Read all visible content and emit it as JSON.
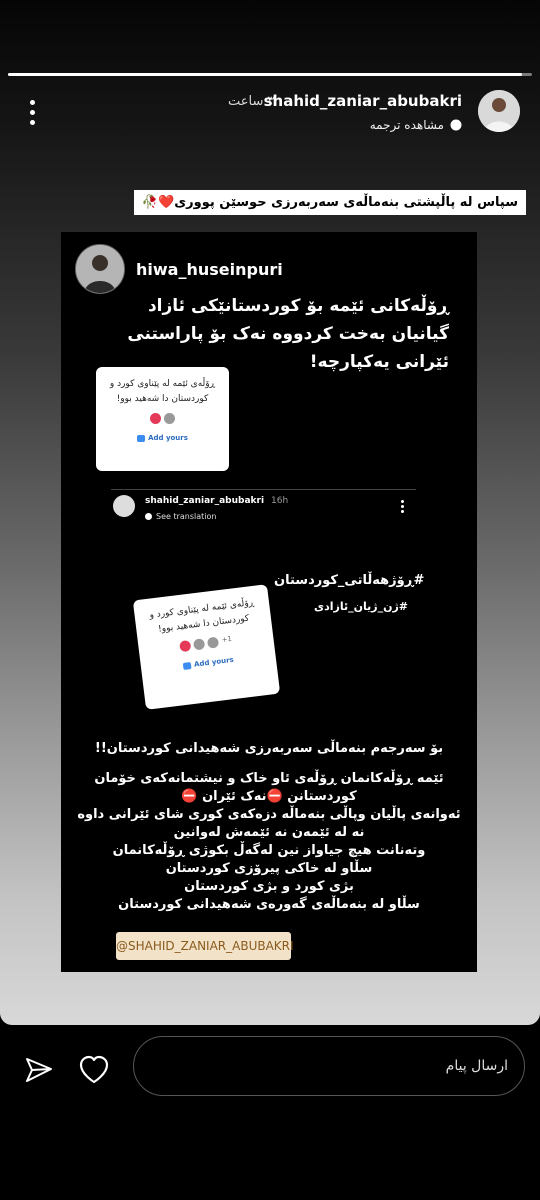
{
  "progress": {
    "fraction": 0.98
  },
  "header": {
    "username": "shahid_zaniar_abubakri",
    "time_ago": "٣ ساعت",
    "translate": "مشاهده ترجمه"
  },
  "caption": {
    "text": "سپاس لە پاڵپشتی بنەماڵەی سەربەرزی  حوسێن پووری❤️🥀"
  },
  "inner": {
    "username": "hiwa_huseinpuri",
    "headline": "ڕۆڵەکانی ئێمە بۆ کوردستانێکی ئازاد گیانیان بەخت کردووە نەک بۆ پاراستنی ئێرانی یەکپارچە!",
    "card1": {
      "text": "ڕۆڵەی ئێمە لە پێناوی کورد و کوردستان دا شەهید بوو!",
      "add": "Add yours"
    },
    "sub": {
      "username": "shahid_zaniar_abubakri",
      "time": "16h",
      "translate": "See translation"
    },
    "hashtag1": "#ڕۆژهەڵاتی_کوردستان",
    "hashtag2": "#ژن_ژیان_ئازادی",
    "card2": {
      "text": "ڕۆڵەی ئێمە لە پێناوی کورد و کوردستان دا شەهید بوو!",
      "count": "+1",
      "add": "Add yours"
    },
    "body": {
      "line1": "بۆ سەرجەم بنەماڵی سەربەرزی شەهیدانی کوردستان!!",
      "lines": [
        "ئێمە ڕۆڵەکانمان ڕۆڵەی ئاو خاک و نیشتمانەکەی خۆمان",
        "کوردستانن ⛔نەک ئێران ⛔",
        "ئەوانەی پاڵیان وپاڵی بنەماڵە دزەکەی کوری شای ئێرانی داوە",
        "نە لە ئێمەن نە ئێمەش لەوانین",
        "وتەنانت هیچ جیاواز نین لەگەڵ بکوژی ڕۆڵەکانمان",
        "سڵاو لە خاکی پیرۆزی کوردستان",
        "بژی کورد و بژی کوردستان",
        "سڵاو لە بنەماڵەی گەورەی شەهیدانی کوردستان"
      ]
    },
    "tag": "@SHAHID_ZANIAR_ABUBAKRI"
  },
  "footer": {
    "message_placeholder": "ارسال پیام"
  }
}
